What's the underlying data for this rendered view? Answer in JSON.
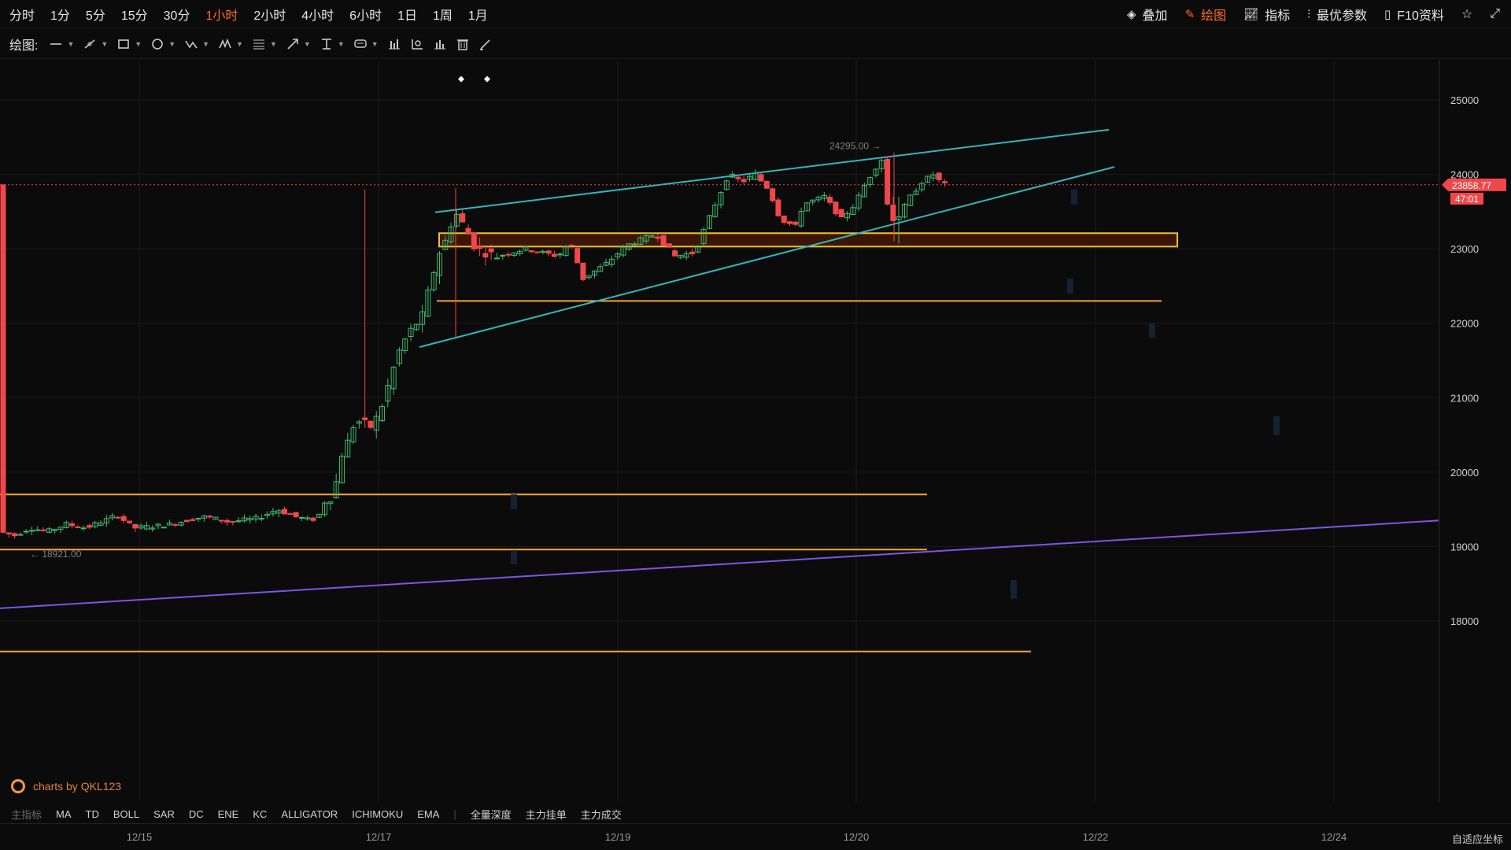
{
  "toolbar": {
    "periods": [
      {
        "label": "分时"
      },
      {
        "label": "1分"
      },
      {
        "label": "5分"
      },
      {
        "label": "15分"
      },
      {
        "label": "30分"
      },
      {
        "label": "1小时"
      },
      {
        "label": "2小时"
      },
      {
        "label": "4小时"
      },
      {
        "label": "6小时"
      },
      {
        "label": "1日"
      },
      {
        "label": "1周"
      },
      {
        "label": "1月"
      }
    ],
    "active_period": "1小时",
    "overlay_label": "叠加",
    "draw_label": "绘图",
    "indicator_label": "指标",
    "best_params_label": "最优参数",
    "f10_label": "F10资料"
  },
  "drawbar": {
    "label": "绘图:",
    "tools": [
      "line-tool-icon",
      "pen-tool-icon",
      "rect-tool-icon",
      "ellipse-tool-icon",
      "wave-tool-icon",
      "pattern-tool-icon",
      "fib-tool-icon",
      "arrow-tool-icon",
      "measure-tool-icon",
      "comment-tool-icon",
      "bars-stat-icon",
      "range-stat-icon",
      "volume-stat-icon",
      "delete-icon",
      "brush-icon"
    ]
  },
  "chart": {
    "y_ticks": [
      "25000",
      "24000",
      "23000",
      "22000",
      "21000",
      "20000",
      "19000",
      "18000"
    ],
    "x_ticks": [
      "12/15",
      "12/17",
      "12/19",
      "12/20",
      "12/22",
      "12/24"
    ],
    "current_price": "23858.77",
    "countdown": "47:01",
    "high_label": "24295.00 →",
    "low_label": "← 18921.00",
    "watermark": "charts by QKL123",
    "price_color": "#f0474b",
    "up_color": "#3fb970",
    "down_color": "#f0474b",
    "channel_color": "#35b4bd",
    "level_color": "#f3a53c",
    "trend_color": "#7a56e8"
  },
  "indicators": {
    "main_label": "主指标",
    "items": [
      "MA",
      "TD",
      "BOLL",
      "SAR",
      "DC",
      "ENE",
      "KC",
      "ALLIGATOR",
      "ICHIMOKU",
      "EMA"
    ],
    "extra": [
      "全量深度",
      "主力挂单",
      "主力成交"
    ]
  },
  "xaxis": {
    "auto_coord_label": "自适应坐标"
  }
}
